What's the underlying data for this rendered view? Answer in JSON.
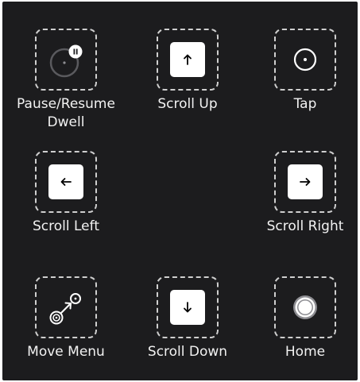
{
  "items": {
    "pause_resume_dwell": {
      "label": "Pause/Resume\nDwell",
      "icon": "dwell-pause-icon"
    },
    "scroll_up": {
      "label": "Scroll Up",
      "icon": "arrow-up-icon"
    },
    "tap": {
      "label": "Tap",
      "icon": "tap-icon"
    },
    "scroll_left": {
      "label": "Scroll Left",
      "icon": "arrow-left-icon"
    },
    "scroll_right": {
      "label": "Scroll Right",
      "icon": "arrow-right-icon"
    },
    "move_menu": {
      "label": "Move Menu",
      "icon": "move-menu-icon"
    },
    "scroll_down": {
      "label": "Scroll Down",
      "icon": "arrow-down-icon"
    },
    "home": {
      "label": "Home",
      "icon": "home-icon"
    }
  },
  "colors": {
    "background": "#1c1c1e",
    "text": "#f2f2f2",
    "dashed_border": "#cfcfcf",
    "key": "#ffffff"
  }
}
